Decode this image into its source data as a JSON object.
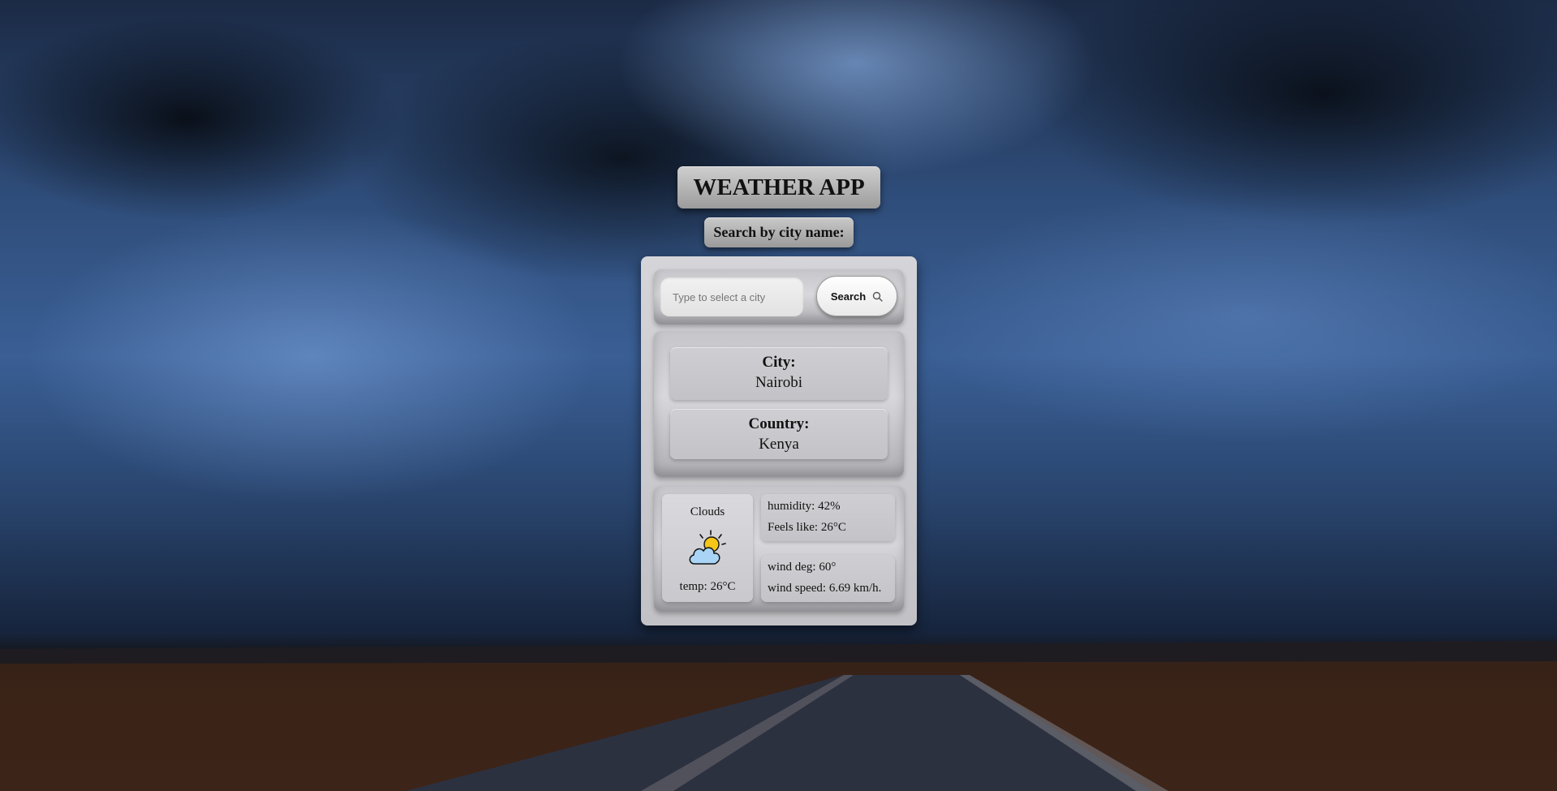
{
  "header": {
    "title": "WEATHER APP",
    "subtitle": "Search by city name:"
  },
  "search": {
    "placeholder": "Type to select a city",
    "button_label": "Search",
    "button_icon": "search-icon"
  },
  "location": {
    "city_label": "City:",
    "city_value": "Nairobi",
    "country_label": "Country:",
    "country_value": "Kenya"
  },
  "weather": {
    "condition": "Clouds",
    "icon": "partly-cloudy-icon",
    "temp": "temp: 26°C",
    "humidity": "humidity: 42%",
    "feels_like": "Feels like: 26°C",
    "wind_deg": "wind deg: 60°",
    "wind_speed": "wind speed: 6.69 km/h."
  },
  "colors": {
    "sun": "#f5c518",
    "cloud": "#a9d4f5",
    "panel": "#c8c8cc"
  }
}
